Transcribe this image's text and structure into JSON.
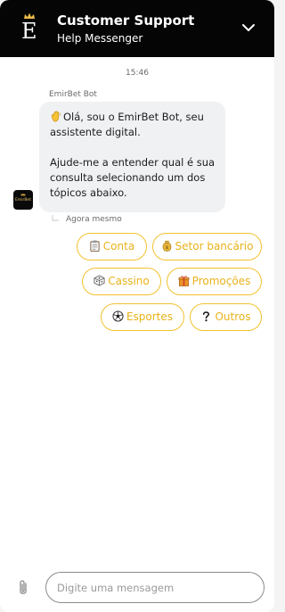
{
  "header": {
    "logo_letter": "E",
    "title": "Customer Support",
    "subtitle": "Help Messenger"
  },
  "conversation": {
    "timestamp": "15:46",
    "bot_name": "EmirBet Bot",
    "avatar_text": "EmirBet",
    "message_line1": "Olá, sou o EmirBet Bot, seu assistente digital.",
    "message_line2": "Ajude-me a entender qual é sua consulta selecionando um dos tópicos abaixo.",
    "message_emoji": "waving-hand-icon",
    "sent_time": "Agora mesmo"
  },
  "quick_replies": [
    {
      "label": "Conta",
      "icon": "clipboard-icon"
    },
    {
      "label": "Setor bancário",
      "icon": "money-bag-icon"
    },
    {
      "label": "Cassino",
      "icon": "dice-icon"
    },
    {
      "label": "Promoções",
      "icon": "gift-icon"
    },
    {
      "label": "Esportes",
      "icon": "soccer-ball-icon"
    },
    {
      "label": "Outros",
      "icon": "question-mark-icon"
    }
  ],
  "composer": {
    "placeholder": "Digite uma mensagem"
  },
  "colors": {
    "header_bg": "#050505",
    "accent": "#f2c12e",
    "bubble_bg": "#f0f1f3"
  }
}
